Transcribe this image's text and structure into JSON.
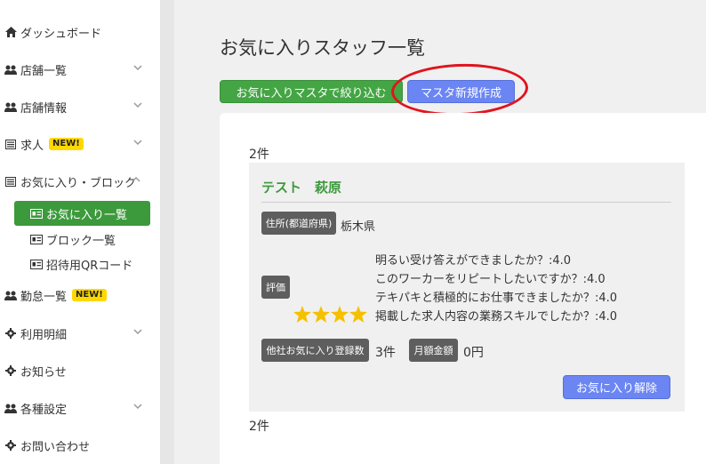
{
  "sidebar": {
    "items": [
      {
        "label": "ダッシュボード",
        "icon": "home-icon"
      },
      {
        "label": "店舗一覧",
        "icon": "users-icon",
        "has_chevron": true
      },
      {
        "label": "店舗情報",
        "icon": "users-icon",
        "has_chevron": true
      },
      {
        "label": "求人",
        "icon": "list-icon",
        "badge": "NEW!",
        "has_chevron": true
      },
      {
        "label": "お気に入り・ブロック",
        "icon": "list-icon",
        "has_chevron": true,
        "expanded": true
      },
      {
        "label": "勤怠一覧",
        "icon": "users-icon",
        "badge": "NEW!"
      },
      {
        "label": "利用明細",
        "icon": "gear-icon",
        "has_chevron": true
      },
      {
        "label": "お知らせ",
        "icon": "gear-icon"
      },
      {
        "label": "各種設定",
        "icon": "users-icon",
        "has_chevron": true
      },
      {
        "label": "お問い合わせ",
        "icon": "gear-icon"
      }
    ],
    "subitems": [
      {
        "label": "お気に入り一覧",
        "active": true
      },
      {
        "label": "ブロック一覧"
      },
      {
        "label": "招待用QRコード"
      }
    ]
  },
  "main": {
    "title": "お気に入りスタッフ一覧",
    "filter_button": "お気に入りマスタで絞り込む",
    "new_master_button": "マスタ新規作成",
    "count_top": "2件",
    "count_bottom": "2件"
  },
  "staff_card": {
    "name": "テスト　萩原",
    "address_label": "住所(都道府県)",
    "address_value": "栃木県",
    "evaluation_label": "評価",
    "rating_stars": 4,
    "evaluations": [
      "明るい受け答えができましたか？:4.0",
      "このワーカーをリピートしたいですか？:4.0",
      "テキパキと積極的にお仕事できましたか？:4.0",
      "掲載した求人内容の業務スキルでしたか？:4.0"
    ],
    "other_fav_label": "他社お気に入り登録数",
    "other_fav_value": "3件",
    "monthly_label": "月額金額",
    "monthly_value": "0円",
    "remove_button": "お気に入り解除"
  },
  "colors": {
    "green": "#44a544",
    "blue": "#6b86f2",
    "star": "#f5c000",
    "highlight": "#e0141e"
  }
}
